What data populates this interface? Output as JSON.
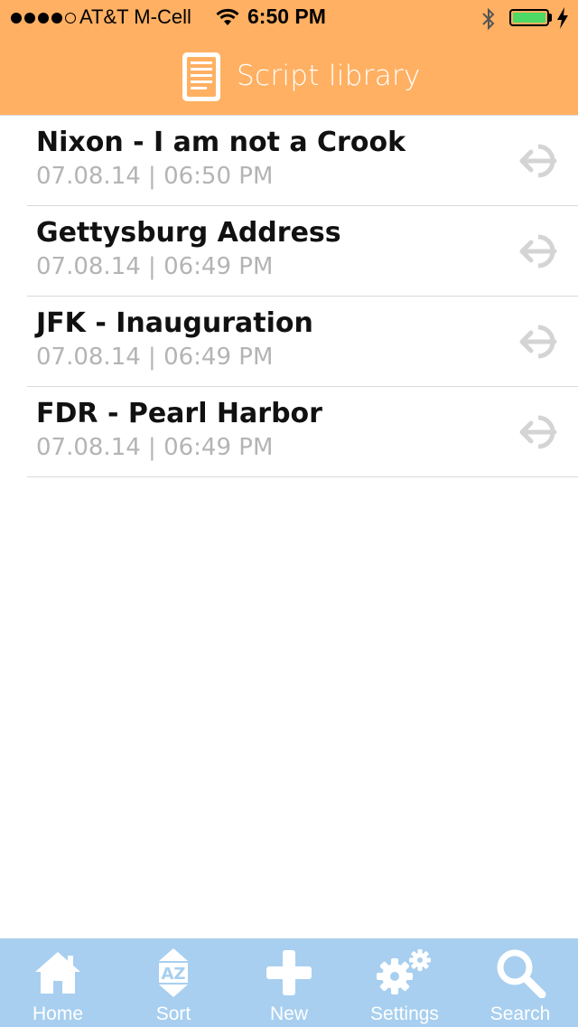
{
  "status_bar": {
    "carrier": "AT&T M-Cell",
    "time": "6:50 PM",
    "signal_bars": 4,
    "battery_color": "#4cd964"
  },
  "nav": {
    "title": "Script library",
    "icon": "document-icon",
    "background": "#FFB062"
  },
  "scripts": [
    {
      "title": "Nixon - I am not a Crook",
      "date": "07.08.14 | 06:50 PM"
    },
    {
      "title": "Gettysburg Address",
      "date": "07.08.14 | 06:49 PM"
    },
    {
      "title": "JFK - Inauguration",
      "date": "07.08.14 | 06:49 PM"
    },
    {
      "title": "FDR - Pearl Harbor",
      "date": "07.08.14 | 06:49 PM"
    }
  ],
  "tabbar": {
    "background": "#A8CFEF",
    "tabs": [
      {
        "label": "Home",
        "icon": "home-icon"
      },
      {
        "label": "Sort",
        "icon": "sort-az-icon"
      },
      {
        "label": "New",
        "icon": "plus-icon"
      },
      {
        "label": "Settings",
        "icon": "gears-icon"
      },
      {
        "label": "Search",
        "icon": "search-icon"
      }
    ]
  }
}
